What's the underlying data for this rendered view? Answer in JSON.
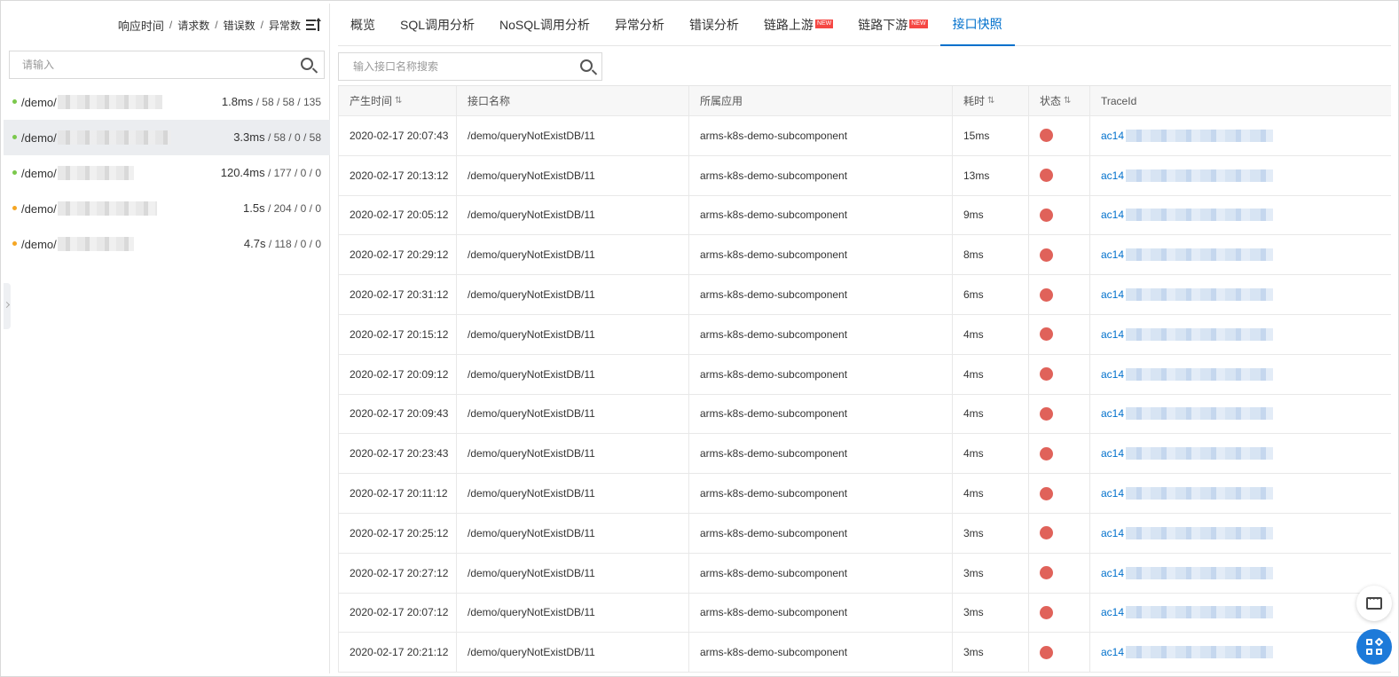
{
  "left": {
    "header": {
      "primary": "响应时间",
      "sep": "/",
      "metric2": "请求数",
      "metric3": "错误数",
      "metric4": "异常数"
    },
    "search_placeholder": "请输入",
    "endpoints": [
      {
        "prefix": "/demo/",
        "rt": "1.8ms",
        "counts": "/ 58 / 58 / 135",
        "status_color": "#7bc84c",
        "selected": false
      },
      {
        "prefix": "/demo/",
        "rt": "3.3ms",
        "counts": "/ 58 / 0 / 58",
        "status_color": "#7bc84c",
        "selected": true
      },
      {
        "prefix": "/demo/",
        "rt": "120.4ms",
        "counts": "/ 177 / 0 / 0",
        "status_color": "#7bc84c",
        "selected": false
      },
      {
        "prefix": "/demo/",
        "rt": "1.5s",
        "counts": "/ 204 / 0 / 0",
        "status_color": "#f5a623",
        "selected": false
      },
      {
        "prefix": "/demo/",
        "rt": "4.7s",
        "counts": "/ 118 / 0 / 0",
        "status_color": "#f5a623",
        "selected": false
      }
    ]
  },
  "tabs": [
    {
      "label": "概览",
      "new": false,
      "active": false
    },
    {
      "label": "SQL调用分析",
      "new": false,
      "active": false
    },
    {
      "label": "NoSQL调用分析",
      "new": false,
      "active": false
    },
    {
      "label": "异常分析",
      "new": false,
      "active": false
    },
    {
      "label": "错误分析",
      "new": false,
      "active": false
    },
    {
      "label": "链路上游",
      "new": true,
      "active": false
    },
    {
      "label": "链路下游",
      "new": true,
      "active": false
    },
    {
      "label": "接口快照",
      "new": false,
      "active": true
    }
  ],
  "new_badge": "NEW",
  "search_placeholder": "输入接口名称搜索",
  "table": {
    "columns": [
      "产生时间",
      "接口名称",
      "所属应用",
      "耗时",
      "状态",
      "TraceId"
    ],
    "status_color": "#e0625a",
    "trace_prefix": "ac14",
    "rows": [
      {
        "time": "2020-02-17 20:07:43",
        "api": "/demo/queryNotExistDB/11",
        "app": "arms-k8s-demo-subcomponent",
        "cost": "15ms"
      },
      {
        "time": "2020-02-17 20:13:12",
        "api": "/demo/queryNotExistDB/11",
        "app": "arms-k8s-demo-subcomponent",
        "cost": "13ms"
      },
      {
        "time": "2020-02-17 20:05:12",
        "api": "/demo/queryNotExistDB/11",
        "app": "arms-k8s-demo-subcomponent",
        "cost": "9ms"
      },
      {
        "time": "2020-02-17 20:29:12",
        "api": "/demo/queryNotExistDB/11",
        "app": "arms-k8s-demo-subcomponent",
        "cost": "8ms"
      },
      {
        "time": "2020-02-17 20:31:12",
        "api": "/demo/queryNotExistDB/11",
        "app": "arms-k8s-demo-subcomponent",
        "cost": "6ms"
      },
      {
        "time": "2020-02-17 20:15:12",
        "api": "/demo/queryNotExistDB/11",
        "app": "arms-k8s-demo-subcomponent",
        "cost": "4ms"
      },
      {
        "time": "2020-02-17 20:09:12",
        "api": "/demo/queryNotExistDB/11",
        "app": "arms-k8s-demo-subcomponent",
        "cost": "4ms"
      },
      {
        "time": "2020-02-17 20:09:43",
        "api": "/demo/queryNotExistDB/11",
        "app": "arms-k8s-demo-subcomponent",
        "cost": "4ms"
      },
      {
        "time": "2020-02-17 20:23:43",
        "api": "/demo/queryNotExistDB/11",
        "app": "arms-k8s-demo-subcomponent",
        "cost": "4ms"
      },
      {
        "time": "2020-02-17 20:11:12",
        "api": "/demo/queryNotExistDB/11",
        "app": "arms-k8s-demo-subcomponent",
        "cost": "4ms"
      },
      {
        "time": "2020-02-17 20:25:12",
        "api": "/demo/queryNotExistDB/11",
        "app": "arms-k8s-demo-subcomponent",
        "cost": "3ms"
      },
      {
        "time": "2020-02-17 20:27:12",
        "api": "/demo/queryNotExistDB/11",
        "app": "arms-k8s-demo-subcomponent",
        "cost": "3ms"
      },
      {
        "time": "2020-02-17 20:07:12",
        "api": "/demo/queryNotExistDB/11",
        "app": "arms-k8s-demo-subcomponent",
        "cost": "3ms"
      },
      {
        "time": "2020-02-17 20:21:12",
        "api": "/demo/queryNotExistDB/11",
        "app": "arms-k8s-demo-subcomponent",
        "cost": "3ms"
      }
    ]
  },
  "icons": {
    "sort": "sort-list-icon",
    "search": "search-icon",
    "chat": "chat-icon",
    "apps": "apps-icon"
  },
  "colors": {
    "accent": "#0070cc",
    "error": "#e0625a",
    "badge": "#f54743"
  }
}
